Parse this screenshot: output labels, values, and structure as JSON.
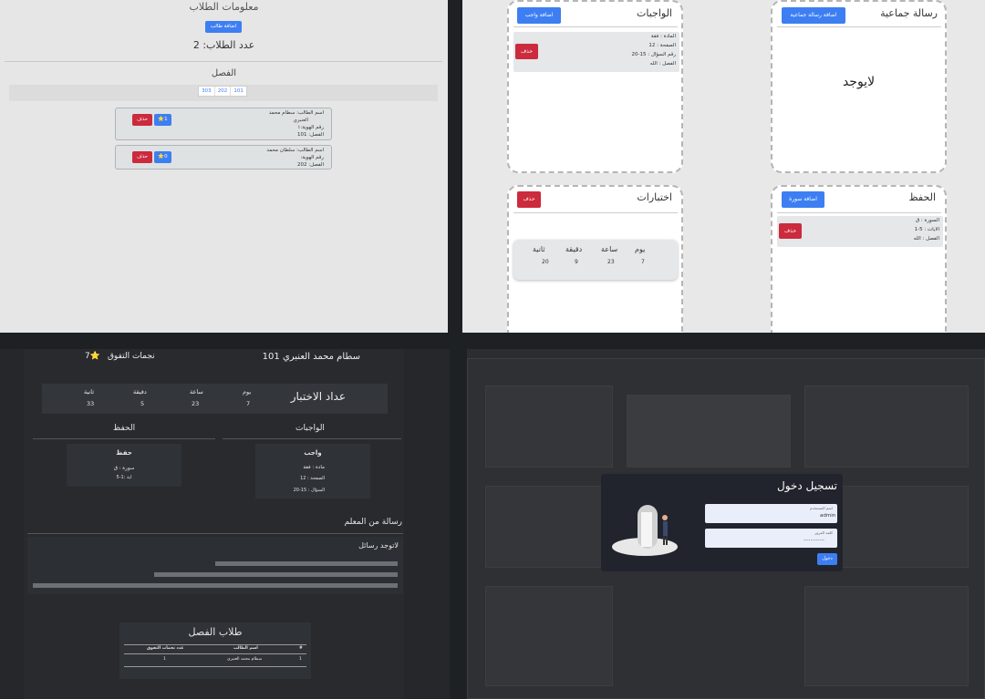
{
  "students_panel": {
    "title": "معلومات الطلاب",
    "add_student_label": "اضافة طالب",
    "count_label": "عدد الطلاب: 2",
    "class_title": "الفصل",
    "class_tabs": [
      "101",
      "202",
      "303"
    ],
    "students": [
      {
        "name": "اسم الطالب: سطام محمد",
        "name2": "العنبري",
        "id": "رقم الهوية:١",
        "class": "الفصل: 101",
        "stars": "1",
        "delete_label": "حذف"
      },
      {
        "name": "اسم الطالب: سلطان محمد",
        "id": "رقم الهوية:",
        "class": "الفصل: 202",
        "stars": "0",
        "delete_label": "حذف"
      }
    ]
  },
  "teacher_panel": {
    "group_message": {
      "title": "رسالة جماعية",
      "add_label": "اضافة رسالة جماعية",
      "empty_text": "لايوجد"
    },
    "homework": {
      "title": "الواجبات",
      "add_label": "اضافة واجب",
      "subject": "المادة : فقة",
      "page": "الصفحة : 12",
      "question": "رقم السؤال : 15-20",
      "class": "الفصل : الله",
      "delete_label": "حذف"
    },
    "memorization": {
      "title": "الحفظ",
      "add_label": "اضافة سورة",
      "surah": "السورة : ق",
      "verses": "الايات : 5-1",
      "class": "الفصل : الله",
      "delete_label": "حذف"
    },
    "exams": {
      "title": "اختبارات",
      "delete_label": "حذف",
      "units": [
        "يوم",
        "ساعة",
        "دقيقة",
        "ثانية"
      ],
      "values": [
        "7",
        "23",
        "9",
        "20"
      ]
    }
  },
  "student_dashboard": {
    "student_name": "سطام محمد العنبري 101",
    "stars_label": "نجمات التفوق",
    "stars_count": "7",
    "exam_countdown_title": "عداد الاختبار",
    "units": [
      "يوم",
      "ساعة",
      "دقيقة",
      "ثانية"
    ],
    "values": [
      "7",
      "23",
      "5",
      "33"
    ],
    "homework_title": "الواجبات",
    "memorization_title": "الحفظ",
    "homework_card": {
      "title": "واجب",
      "subject": "مادة : فقة",
      "page": "الصفحة : 12",
      "question": "السؤال : 15-20"
    },
    "memorization_card": {
      "title": "حفظ",
      "surah": "سورة : ق",
      "verse": "اية :1-5"
    },
    "teacher_message_title": "رسالة من المعلم",
    "no_messages": "لاتوجد رسائل",
    "class_students_title": "طلاب الفصل",
    "table_headers": [
      "#",
      "اسم الطالب",
      "عدد نجمات التفوق"
    ],
    "table_rows": [
      [
        "1",
        "سطام محمد العنبري",
        "1"
      ]
    ]
  },
  "login": {
    "title": "تسجيل دخول",
    "username_label": "اسم المستخدم",
    "username_value": "admin",
    "password_label": "كلمة المرور",
    "password_value": "............",
    "submit_label": "دخول"
  },
  "colors": {
    "primary": "#3d7ff2",
    "danger": "#cc2a3d",
    "dark_bg": "#25272b"
  }
}
